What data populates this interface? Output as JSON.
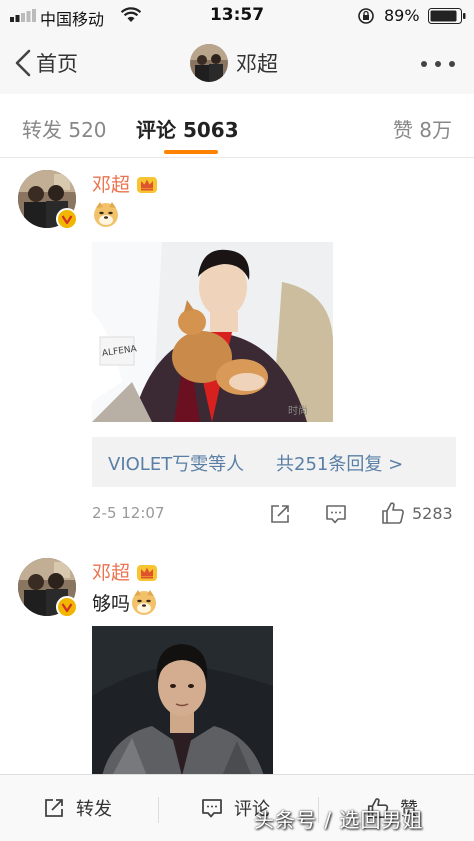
{
  "status_bar": {
    "carrier": "中国移动",
    "time": "13:57",
    "battery_pct": "89%"
  },
  "nav": {
    "back_label": "首页",
    "title": "邓超"
  },
  "tabs": {
    "repost": "转发 520",
    "comment": "评论 5063",
    "like": "赞 8万"
  },
  "comments": [
    {
      "author": "邓超",
      "text": "",
      "replies_users": "VIOLET丂雯等人",
      "replies_count": "共251条回复 >",
      "time": "2-5 12:07",
      "likes": "5283",
      "photo_watermark": "时尚"
    },
    {
      "author": "邓超",
      "text": "够吗"
    }
  ],
  "toolbar": {
    "repost": "转发",
    "comment": "评论",
    "like": "赞"
  },
  "watermark": "头条号 / 选回男姐",
  "colors": {
    "accent": "#ff8200",
    "name": "#eb7350",
    "link": "#5a7fa6"
  }
}
